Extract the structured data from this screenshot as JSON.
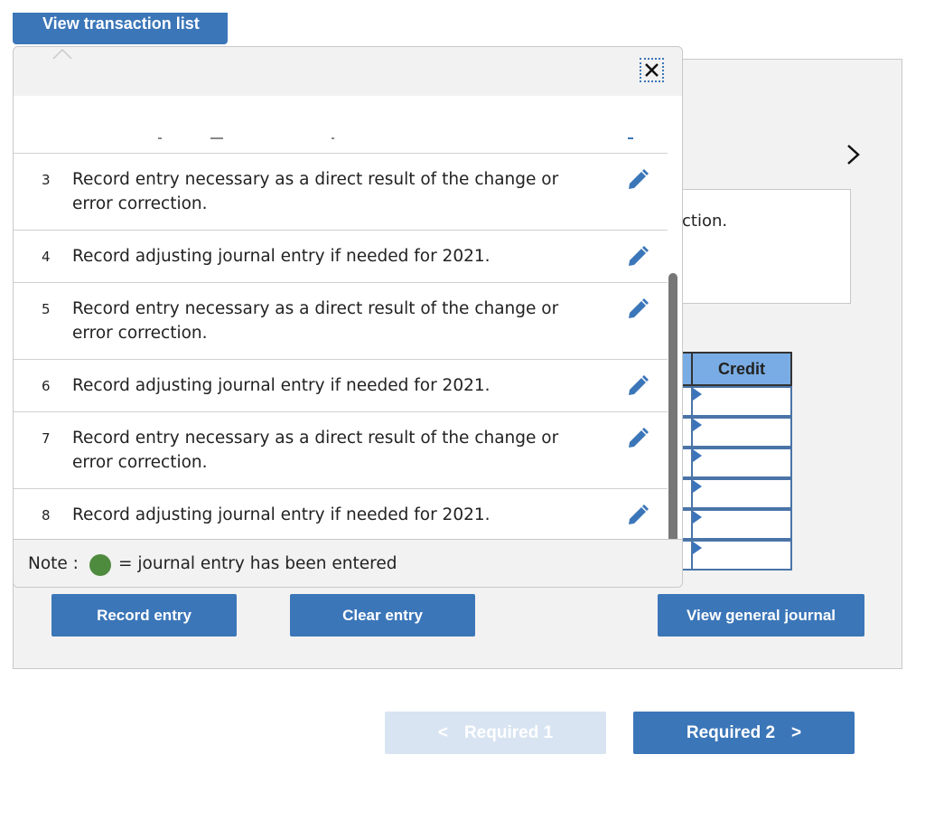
{
  "popup": {
    "tab_label": "View transaction list",
    "close_icon": "close-icon",
    "transactions": [
      {
        "num": "3",
        "text": "Record entry necessary as a direct result of the change or error correction.",
        "icon": "pencil-icon"
      },
      {
        "num": "4",
        "text": "Record adjusting journal entry if needed for 2021.",
        "icon": "pencil-icon"
      },
      {
        "num": "5",
        "text": "Record entry necessary as a direct result of the change or error correction.",
        "icon": "pencil-icon"
      },
      {
        "num": "6",
        "text": "Record adjusting journal entry if needed for 2021.",
        "icon": "pencil-icon"
      },
      {
        "num": "7",
        "text": "Record entry necessary as a direct result of the change or error correction.",
        "icon": "pencil-icon"
      },
      {
        "num": "8",
        "text": "Record adjusting journal entry if needed for 2021.",
        "icon": "pencil-icon"
      }
    ],
    "note_label": "Note :",
    "note_text": "= journal entry has been entered",
    "note_color": "#4e8b3f"
  },
  "main": {
    "description_fragment": "ction.",
    "credit_header": "Credit",
    "credit_rows": [
      "",
      "",
      "",
      "",
      "",
      ""
    ],
    "record_entry": "Record entry",
    "clear_entry": "Clear entry",
    "view_general_journal": "View general journal"
  },
  "nav": {
    "prev_label": "Required 1",
    "next_label": "Required 2"
  },
  "colors": {
    "accent": "#3b76b8",
    "header_blue": "#79ace4",
    "disabled": "#d8e4f2"
  }
}
